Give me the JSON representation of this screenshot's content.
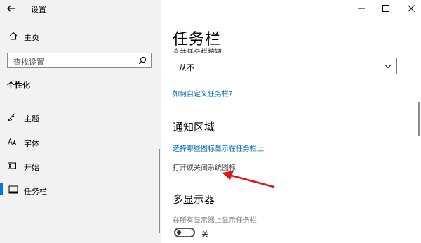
{
  "window": {
    "title": "设置"
  },
  "sidebar": {
    "home_label": "主页",
    "search_placeholder": "查找设置",
    "section_title": "个性化",
    "items": [
      {
        "label": "主题"
      },
      {
        "label": "字体"
      },
      {
        "label": "开始"
      },
      {
        "label": "任务栏"
      }
    ]
  },
  "main": {
    "page_title": "任务栏",
    "cut_off_label": "合并任务栏按钮",
    "dropdown_value": "从不",
    "customize_link": "如何自定义任务栏?",
    "notification_area": {
      "heading": "通知区域",
      "select_icons_link": "选择哪些图标显示在任务栏上",
      "system_icons_link": "打开或关闭系统图标"
    },
    "multiple_displays": {
      "heading": "多显示器",
      "show_on_all_label": "在所有显示器上显示任务栏",
      "toggle_state": "关"
    }
  },
  "colors": {
    "sidebar_bg": "#f2f2f2",
    "accent": "#0078d7",
    "link": "#0066b4",
    "annotation_arrow": "#e0161b"
  }
}
